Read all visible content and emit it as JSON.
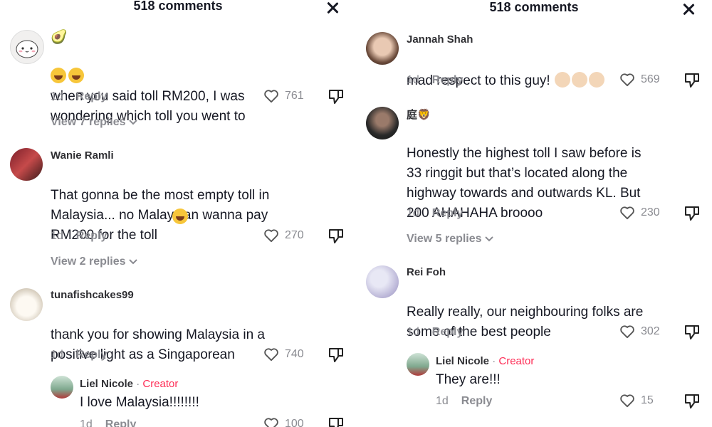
{
  "left": {
    "title": "518 comments",
    "comments": [
      {
        "user": "🥑",
        "text": "when you said toll RM200, I was\nwondering which toll you went to",
        "time": "1d",
        "reply": "Reply",
        "likes": "761",
        "view_replies": "View 7 replies"
      },
      {
        "user": "Wanie Ramli",
        "text": "That gonna be the most empty toll in\nMalaysia... no Malaysian wanna pay\nRM200 for the toll",
        "time": "1d",
        "reply": "Reply",
        "likes": "270",
        "view_replies": "View 2 replies"
      },
      {
        "user": "tunafishcakes99",
        "text": "thank you for showing Malaysia in a\npositive light as a Singaporean",
        "time": "1d",
        "reply": "Reply",
        "likes": "740"
      }
    ],
    "reply": {
      "user": "Liel Nicole",
      "dot": " · ",
      "badge": "Creator",
      "text": "I love Malaysia!!!!!!!!",
      "time": "1d",
      "reply": "Reply",
      "likes": "100"
    }
  },
  "right": {
    "title": "518 comments",
    "comments": [
      {
        "user": "Jannah Shah",
        "text": "mad respect to this guy!",
        "time": "1d",
        "reply": "Reply",
        "likes": "569"
      },
      {
        "user": "庭🦁",
        "text": "Honestly the highest toll I saw before is\n33 ringgit but that’s located along the\nhighway towards and outwards KL. But\n200 AHAHAHA broooo",
        "time": "1d",
        "reply": "Reply",
        "likes": "230",
        "view_replies": "View 5 replies"
      },
      {
        "user": "Rei Foh",
        "text": "Really really, our neighbouring folks are\nsome of the best people",
        "time": "1d",
        "reply": "Reply",
        "likes": "302"
      }
    ],
    "reply": {
      "user": "Liel Nicole",
      "dot": " · ",
      "badge": "Creator",
      "text": "They are!!!",
      "time": "1d",
      "reply": "Reply",
      "likes": "15"
    }
  },
  "icons": {
    "close": "close-icon",
    "like": "heart-outline-icon",
    "dislike": "thumbs-down-icon",
    "chevron": "chevron-down-icon"
  },
  "colors": {
    "creator": "#fe2c55",
    "muted": "#8a8b91",
    "text": "#161823"
  }
}
